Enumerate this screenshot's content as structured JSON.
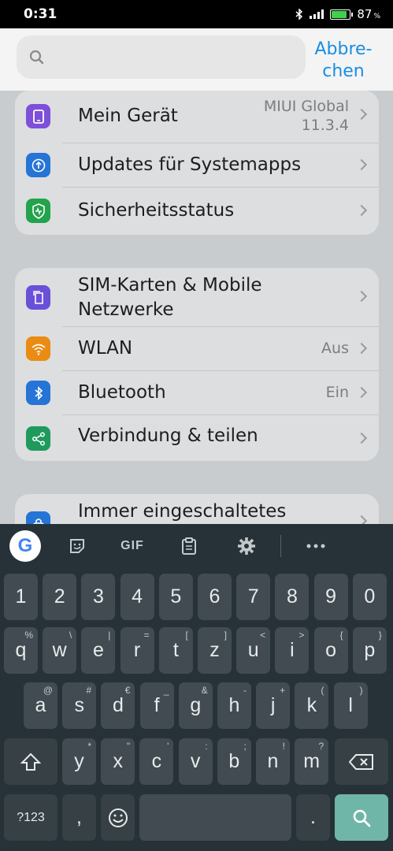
{
  "status_bar": {
    "time": "0:31",
    "battery_percent": "87",
    "battery_unit": "%"
  },
  "search": {
    "placeholder": "",
    "value": "",
    "cancel_label": "Abbre-chen",
    "cancel_line1": "Abbre-",
    "cancel_line2": "chen"
  },
  "settings": {
    "group1": [
      {
        "label": "Mein Gerät",
        "value_line1": "MIUI Global",
        "value_line2": "11.3.4",
        "icon": "device-icon",
        "color": "#7e4fd8"
      },
      {
        "label": "Updates für Systemapps",
        "icon": "update-icon",
        "color": "#2574d6"
      },
      {
        "label": "Sicherheitsstatus",
        "icon": "shield-icon",
        "color": "#22a34c"
      }
    ],
    "group2": [
      {
        "label_line1": "SIM-Karten & Mobile",
        "label_line2": "Netzwerke",
        "icon": "sim-icon",
        "color": "#6a4fd9"
      },
      {
        "label": "WLAN",
        "value": "Aus",
        "icon": "wifi-icon",
        "color": "#ea8c13"
      },
      {
        "label": "Bluetooth",
        "value": "Ein",
        "icon": "bluetooth-icon",
        "color": "#2574d6"
      },
      {
        "label": "Verbindung & teilen",
        "icon": "share-icon",
        "color": "#1f9a5c"
      }
    ],
    "group3": [
      {
        "label": "Immer eingeschaltetes",
        "icon": "lock-icon",
        "color": "#2574d6"
      }
    ]
  },
  "keyboard": {
    "toolbar": {
      "gif_label": "GIF",
      "google_label": "G"
    },
    "row_numbers": [
      "1",
      "2",
      "3",
      "4",
      "5",
      "6",
      "7",
      "8",
      "9",
      "0"
    ],
    "row1": [
      {
        "k": "q",
        "h": "%"
      },
      {
        "k": "w",
        "h": "\\"
      },
      {
        "k": "e",
        "h": "|"
      },
      {
        "k": "r",
        "h": "="
      },
      {
        "k": "t",
        "h": "["
      },
      {
        "k": "z",
        "h": "]"
      },
      {
        "k": "u",
        "h": "<"
      },
      {
        "k": "i",
        "h": ">"
      },
      {
        "k": "o",
        "h": "{"
      },
      {
        "k": "p",
        "h": "}"
      }
    ],
    "row2": [
      {
        "k": "a",
        "h": "@"
      },
      {
        "k": "s",
        "h": "#"
      },
      {
        "k": "d",
        "h": "€"
      },
      {
        "k": "f",
        "h": "_"
      },
      {
        "k": "g",
        "h": "&"
      },
      {
        "k": "h",
        "h": "-"
      },
      {
        "k": "j",
        "h": "+"
      },
      {
        "k": "k",
        "h": "("
      },
      {
        "k": "l",
        "h": ")"
      }
    ],
    "row3": [
      {
        "k": "y",
        "h": "*"
      },
      {
        "k": "x",
        "h": "\""
      },
      {
        "k": "c",
        "h": "'"
      },
      {
        "k": "v",
        "h": ":"
      },
      {
        "k": "b",
        "h": ";"
      },
      {
        "k": "n",
        "h": "!"
      },
      {
        "k": "m",
        "h": "?"
      }
    ],
    "symbols_label": "?123",
    "comma_label": ",",
    "period_label": ".",
    "colors": {
      "background": "#263238",
      "key": "#414b51",
      "action": "#6fb6a8"
    }
  }
}
